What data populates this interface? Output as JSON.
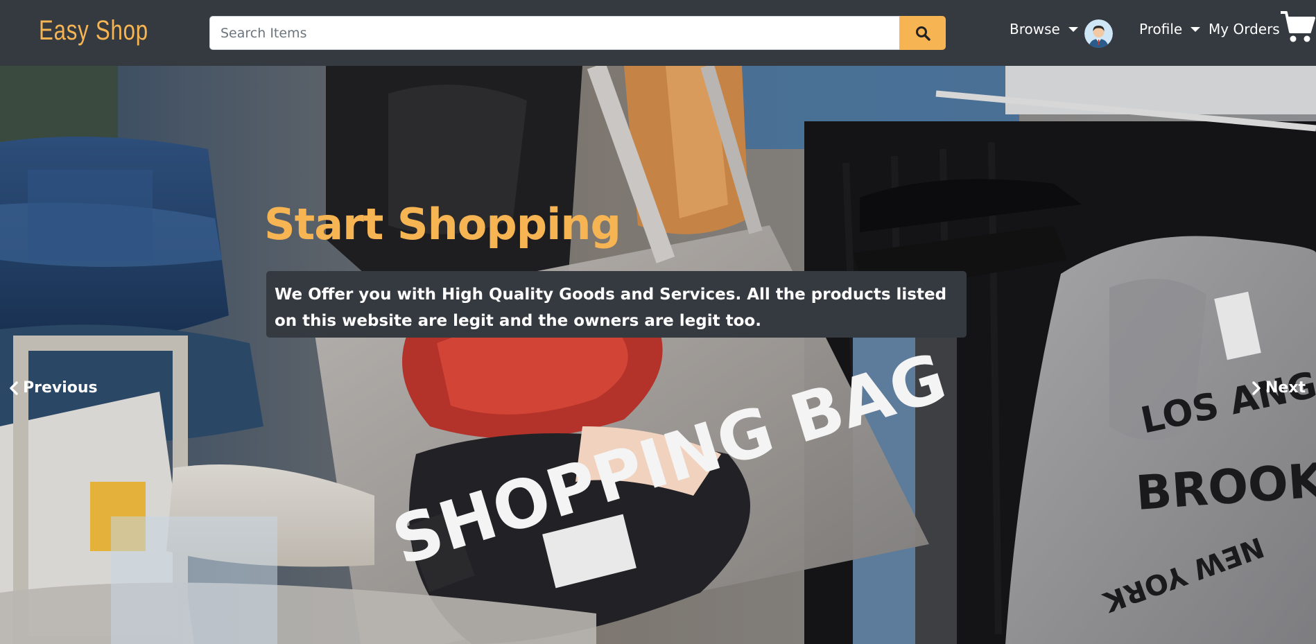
{
  "brand": {
    "name": "Easy Shop"
  },
  "search": {
    "placeholder": "Search Items",
    "button_icon": "search-icon"
  },
  "nav": {
    "browse_label": "Browse",
    "profile_label": "Profile",
    "orders_label": "My Orders",
    "cart_icon": "shopping-cart-icon",
    "avatar_icon": "user-avatar-icon"
  },
  "hero": {
    "title": "Start Shopping",
    "description": "We Offer you with High Quality Goods and Services. All the products listed on this website are legit and the owners are legit too.",
    "bag_text": "SHOPPING BAG",
    "hoodie_text_1": "LOS ANGELES",
    "hoodie_text_2": "BROOKLYN",
    "hoodie_text_3": "NEW YORK",
    "prev_label": "Previous",
    "next_label": "Next"
  },
  "colors": {
    "navbar": "#343a40",
    "accent": "#f6b453",
    "text_light": "#ffffff"
  }
}
